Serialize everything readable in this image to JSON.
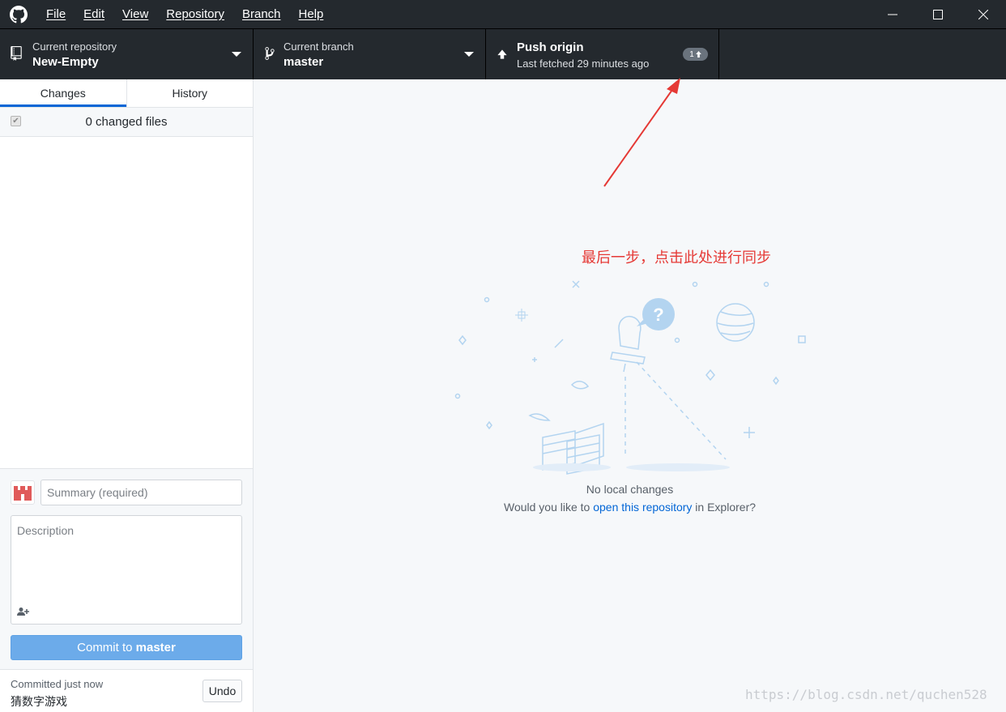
{
  "menu": [
    "File",
    "Edit",
    "View",
    "Repository",
    "Branch",
    "Help"
  ],
  "toolbar": {
    "repo_label": "Current repository",
    "repo_value": "New-Empty",
    "branch_label": "Current branch",
    "branch_value": "master",
    "push_title": "Push origin",
    "push_sub": "Last fetched 29 minutes ago",
    "ahead_count": "1"
  },
  "sidebar": {
    "tabs": [
      "Changes",
      "History"
    ],
    "changed_files": "0 changed files",
    "summary_placeholder": "Summary (required)",
    "description_placeholder": "Description",
    "commit_prefix": "Commit to ",
    "commit_branch": "master",
    "last_commit_label": "Committed just now",
    "last_commit_message": "猜数字游戏",
    "undo_label": "Undo"
  },
  "main": {
    "annotation": "最后一步，点击此处进行同步",
    "no_changes": "No local changes",
    "open_prefix": "Would you like to ",
    "open_link": "open this repository",
    "open_suffix": " in Explorer?"
  },
  "watermark": "https://blog.csdn.net/quchen528",
  "colors": {
    "dark": "#24292e",
    "accent": "#0366d6",
    "commit_button": "#6cabea",
    "annotation_red": "#e53935"
  }
}
